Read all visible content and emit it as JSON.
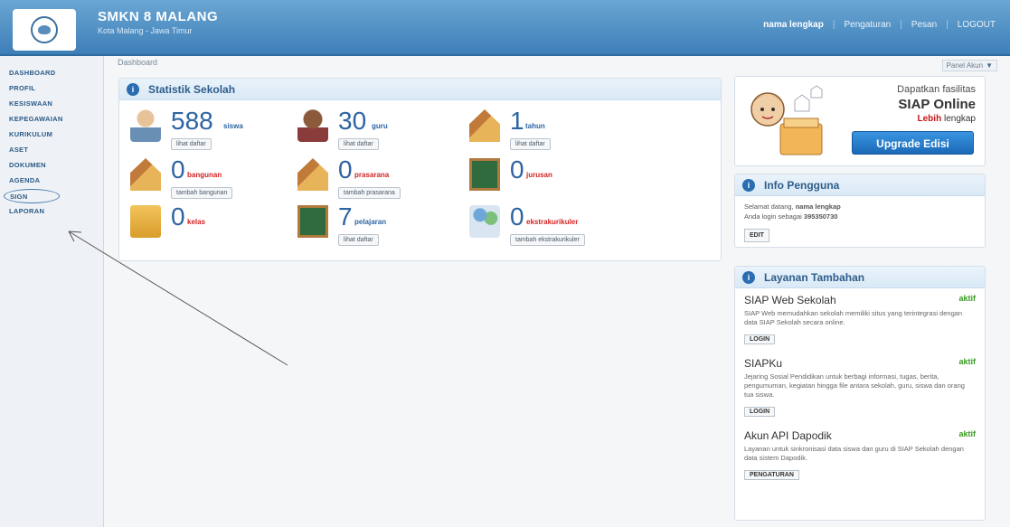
{
  "header": {
    "school_name": "SMKN 8 MALANG",
    "school_city": "Kota Malang - Jawa Timur",
    "user": "nama lengkap",
    "nav": [
      "Pengaturan",
      "Pesan",
      "LOGOUT"
    ]
  },
  "sidebar": {
    "items": [
      "DASHBOARD",
      "PROFIL",
      "KESISWAAN",
      "KEPEGAWAIAN",
      "KURIKULUM",
      "ASET",
      "DOKUMEN",
      "AGENDA",
      "SIGN",
      "LAPORAN"
    ]
  },
  "breadcrumb": "Dashboard",
  "panel_akun": "Panel Akun",
  "stats": {
    "title": "Statistik Sekolah",
    "items": [
      {
        "num": "588",
        "label": "siswa",
        "button": "lihat daftar",
        "icon": "student-icon",
        "color": "blue"
      },
      {
        "num": "30",
        "label": "guru",
        "button": "lihat daftar",
        "icon": "teacher-icon",
        "color": "blue"
      },
      {
        "num": "1",
        "label": "tahun",
        "button": "lihat daftar",
        "icon": "year-house-icon",
        "color": "blue"
      },
      {
        "num": "0",
        "label": "bangunan",
        "button": "tambah bangunan",
        "icon": "building-icon",
        "color": "red"
      },
      {
        "num": "0",
        "label": "prasarana",
        "button": "tambah prasarana",
        "icon": "facility-icon",
        "color": "red"
      },
      {
        "num": "0",
        "label": "jurusan",
        "button": "",
        "icon": "major-board-icon",
        "color": "red"
      },
      {
        "num": "0",
        "label": "kelas",
        "button": "",
        "icon": "class-icon",
        "color": "red"
      },
      {
        "num": "7",
        "label": "pelajaran",
        "button": "lihat daftar",
        "icon": "lesson-board-icon",
        "color": "blue"
      },
      {
        "num": "0",
        "label": "ekstrakurikuler",
        "button": "tambah ekstrakurikuler",
        "icon": "extracurricular-icon",
        "color": "red"
      }
    ]
  },
  "promo": {
    "line1": "Dapatkan fasilitas",
    "line2": "SIAP Online",
    "line3_red": "Lebih",
    "line3_rest": "lengkap",
    "button": "Upgrade Edisi"
  },
  "userinfo": {
    "title": "Info Pengguna",
    "line1_pre": "Selamat datang,",
    "line1_name": "nama lengkap",
    "line2_pre": "Anda login sebagai",
    "line2_id": "395350730",
    "button": "EDIT"
  },
  "layanan": {
    "title": "Layanan Tambahan",
    "services": [
      {
        "name": "SIAP Web Sekolah",
        "status": "aktif",
        "desc": "SIAP Web memudahkan sekolah memiliki situs yang terintegrasi dengan data SIAP Sekolah secara online.",
        "button": "LOGIN"
      },
      {
        "name": "SIAPKu",
        "status": "aktif",
        "desc": "Jejaring Sosial Pendidikan untuk berbagi informasi, tugas, berita, pengumuman, kegiatan hingga file antara sekolah, guru, siswa dan orang tua siswa.",
        "button": "LOGIN"
      },
      {
        "name": "Akun API Dapodik",
        "status": "aktif",
        "desc": "Layanan untuk sinkronisasi data siswa dan guru di SIAP Sekolah dengan data sistem Dapodik.",
        "button": "PENGATURAN"
      }
    ]
  }
}
